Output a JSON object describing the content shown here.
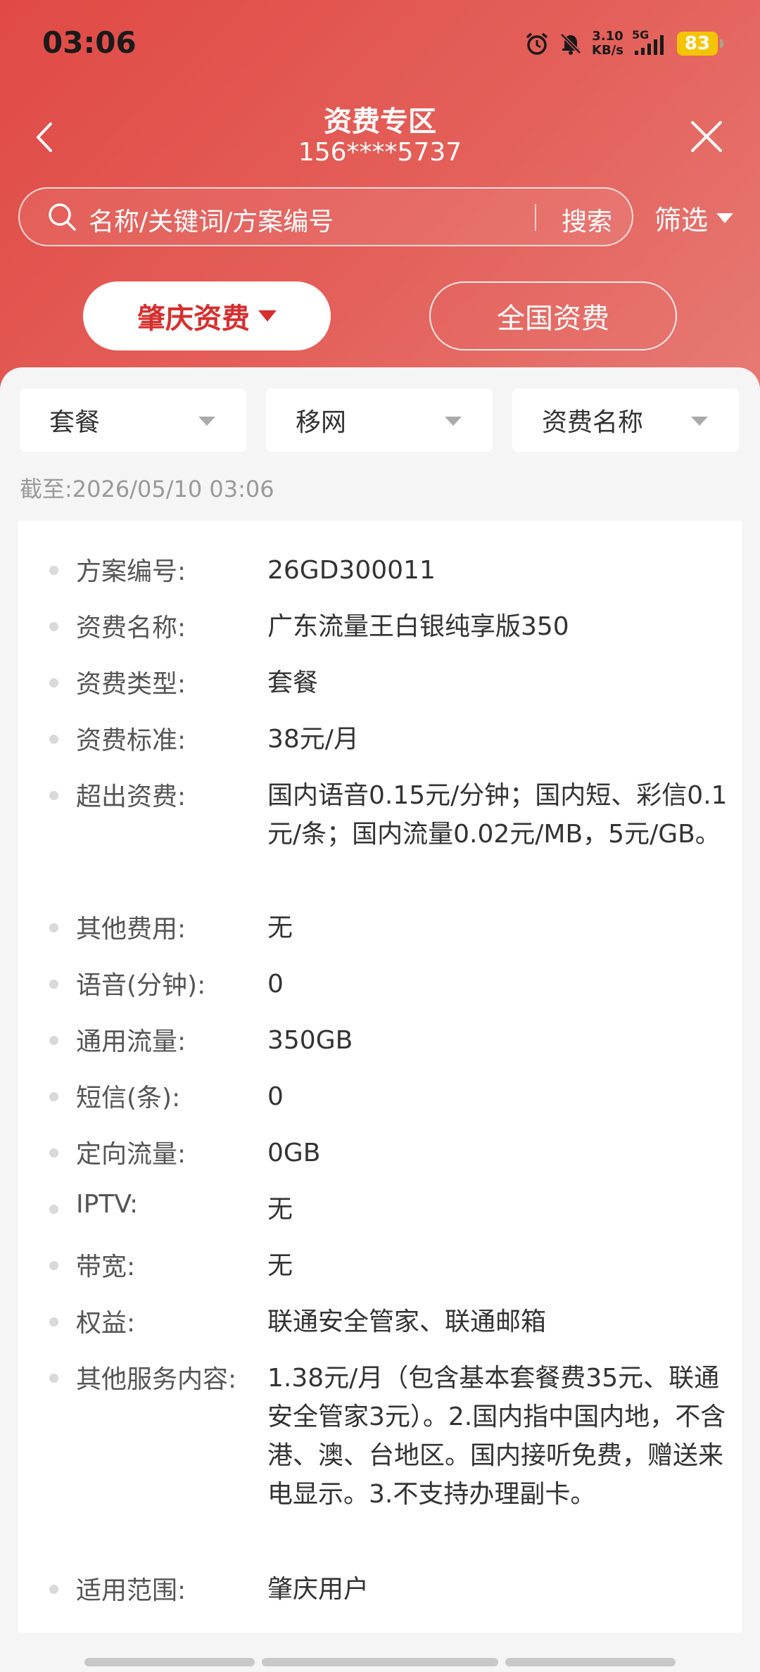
{
  "status_bar": {
    "time": "03:06",
    "net_speed_value": "3.10",
    "net_speed_unit": "KB/s",
    "net_type": "5G",
    "battery": "83",
    "icons": [
      "alarm-icon",
      "mute-bell-icon",
      "signal-icon",
      "battery-icon"
    ]
  },
  "nav": {
    "title": "资费专区",
    "subtitle": "156****5737"
  },
  "search": {
    "placeholder": "名称/关键词/方案编号",
    "button_label": "搜索",
    "filter_label": "筛选"
  },
  "tabs": [
    {
      "label": "肇庆资费",
      "selected": true
    },
    {
      "label": "全国资费",
      "selected": false
    }
  ],
  "dropdowns": [
    "套餐",
    "移网",
    "资费名称"
  ],
  "timestamp": {
    "label": "截至:",
    "value": "2026/05/10 03:06"
  },
  "details": [
    {
      "label": "方案编号:",
      "value": "26GD300011"
    },
    {
      "label": "资费名称:",
      "value": "广东流量王白银纯享版350"
    },
    {
      "label": "资费类型:",
      "value": "套餐"
    },
    {
      "label": "资费标准:",
      "value": "38元/月"
    },
    {
      "label": "超出资费:",
      "value": "国内语音0.15元/分钟；国内短、彩信0.1元/条；国内流量0.02元/MB，5元/GB。"
    },
    {
      "label": "其他费用:",
      "value": "无"
    },
    {
      "label": "语音(分钟):",
      "value": "0"
    },
    {
      "label": "通用流量:",
      "value": "350GB"
    },
    {
      "label": "短信(条):",
      "value": "0"
    },
    {
      "label": "定向流量:",
      "value": "0GB"
    },
    {
      "label": "IPTV:",
      "value": "无"
    },
    {
      "label": "带宽:",
      "value": "无"
    },
    {
      "label": "权益:",
      "value": "联通安全管家、联通邮箱"
    },
    {
      "label": "其他服务内容:",
      "value": "1.38元/月（包含基本套餐费35元、联通安全管家3元）。2.国内指中国内地，不含港、澳、台地区。国内接听免费，赠送来电显示。3.不支持办理副卡。"
    },
    {
      "label": "适用范围:",
      "value": "肇庆用户"
    }
  ],
  "colors": {
    "header_red": "#e04a45",
    "accent_red": "#d62f2f",
    "battery_yellow": "#f5c400"
  }
}
